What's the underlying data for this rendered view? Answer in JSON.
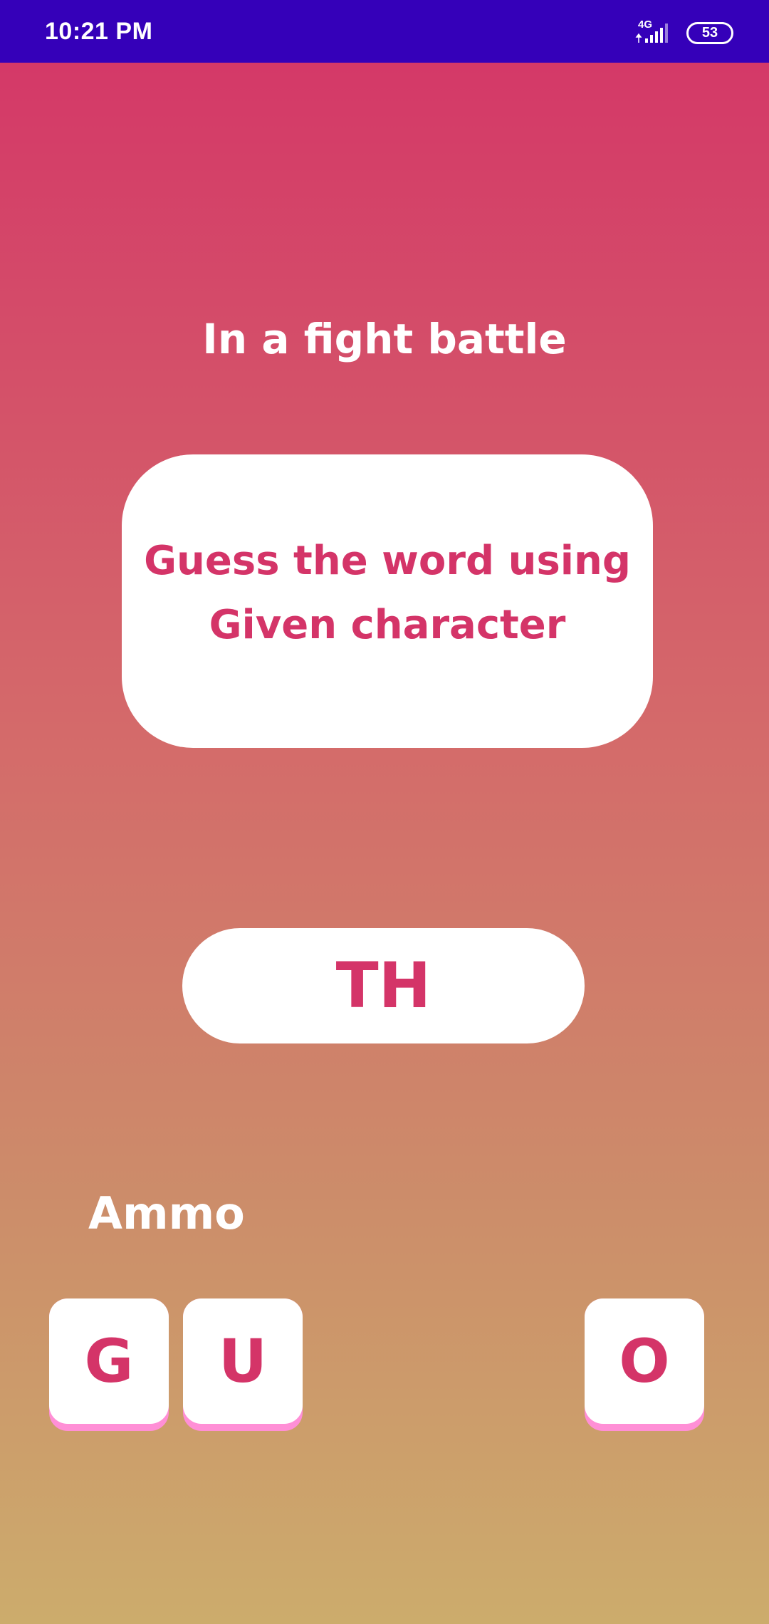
{
  "status_bar": {
    "time": "10:21 PM",
    "network_type": "4G",
    "signal_icon": "signal-strength-icon",
    "battery_level": "53",
    "battery_icon": "battery-icon"
  },
  "game": {
    "title": "In a fight battle",
    "instruction": "Guess the word using Given character",
    "given_characters": "TH",
    "ammo_label": "Ammo",
    "ammo_tiles": [
      "G",
      "U",
      "O"
    ]
  },
  "colors": {
    "status_bar_bg": "#3500b9",
    "accent": "#d43468",
    "tile_shadow": "#ff8fd6",
    "gradient_top": "#d43468",
    "gradient_bottom": "#ccac6c"
  }
}
